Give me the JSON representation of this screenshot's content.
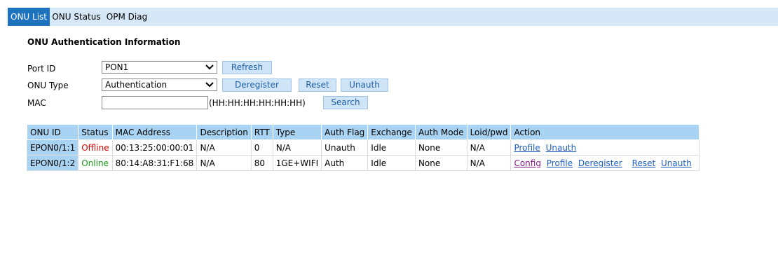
{
  "tabs": [
    "ONU List",
    "ONU Status",
    "OPM Diag"
  ],
  "section_title": "ONU Authentication Information",
  "form": {
    "port_id_label": "Port ID",
    "port_id_value": "PON1",
    "onu_type_label": "ONU Type",
    "onu_type_value": "Authentication",
    "mac_label": "MAC",
    "mac_value": "",
    "mac_hint": "(HH:HH:HH:HH:HH:HH)",
    "buttons": {
      "refresh": "Refresh",
      "deregister": "Deregister",
      "reset": "Reset",
      "unauth": "Unauth",
      "search": "Search"
    }
  },
  "table": {
    "headers": [
      "ONU ID",
      "Status",
      "MAC Address",
      "Description",
      "RTT",
      "Type",
      "Auth Flag",
      "Exchange",
      "Auth Mode",
      "Loid/pwd",
      "Action"
    ],
    "rows": [
      {
        "onu_id": "EPON0/1:1",
        "status": "Offline",
        "mac": "00:13:25:00:00:01",
        "description": "N/A",
        "rtt": "0",
        "type": "N/A",
        "auth_flag": "Unauth",
        "exchange": "Idle",
        "auth_mode": "None",
        "loid": "N/A",
        "actions": [
          "Profile",
          "Unauth"
        ]
      },
      {
        "onu_id": "EPON0/1:2",
        "status": "Online",
        "mac": "80:14:A8:31:F1:68",
        "description": "N/A",
        "rtt": "80",
        "type": "1GE+WIFI",
        "auth_flag": "Auth",
        "exchange": "Idle",
        "auth_mode": "None",
        "loid": "N/A",
        "actions": [
          "Config",
          "Profile",
          "Deregister",
          "Reset",
          "Unauth"
        ]
      }
    ]
  },
  "colors": {
    "tab_active": "#1e73c0",
    "tab_bar": "#d6e8f7",
    "header_bg": "#a9d3f2",
    "offline": "#e00000",
    "online": "#1a9a1a",
    "link": "#1e5fc0"
  }
}
